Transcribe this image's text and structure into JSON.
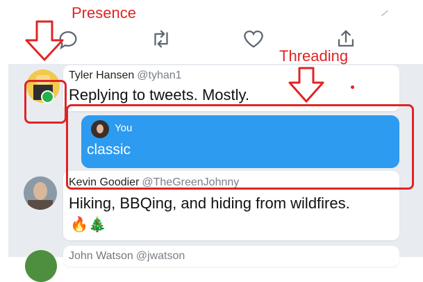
{
  "annotations": {
    "presence_label": "Presence",
    "threading_label": "Threading",
    "color": "#e02424"
  },
  "actions": {
    "reply_icon": "reply-icon",
    "retweet_icon": "retweet-icon",
    "like_icon": "heart-icon",
    "share_icon": "share-icon"
  },
  "tweets": [
    {
      "name": "Tyler Hansen",
      "handle": "@tyhan1",
      "text": "Replying to tweets. Mostly.",
      "presence": "online"
    },
    {
      "reply_name": "You",
      "reply_text": "classic"
    },
    {
      "name": "Kevin Goodier",
      "handle": "@TheGreenJohnny",
      "text": "Hiking, BBQing, and hiding from wildfires.",
      "emoji": "🔥🎄"
    },
    {
      "name": "John Watson",
      "handle": "@jwatson"
    }
  ],
  "colors": {
    "bubble": "#2d9bf0",
    "presence_dot": "#22b14c",
    "background": "#e8ecf1"
  }
}
